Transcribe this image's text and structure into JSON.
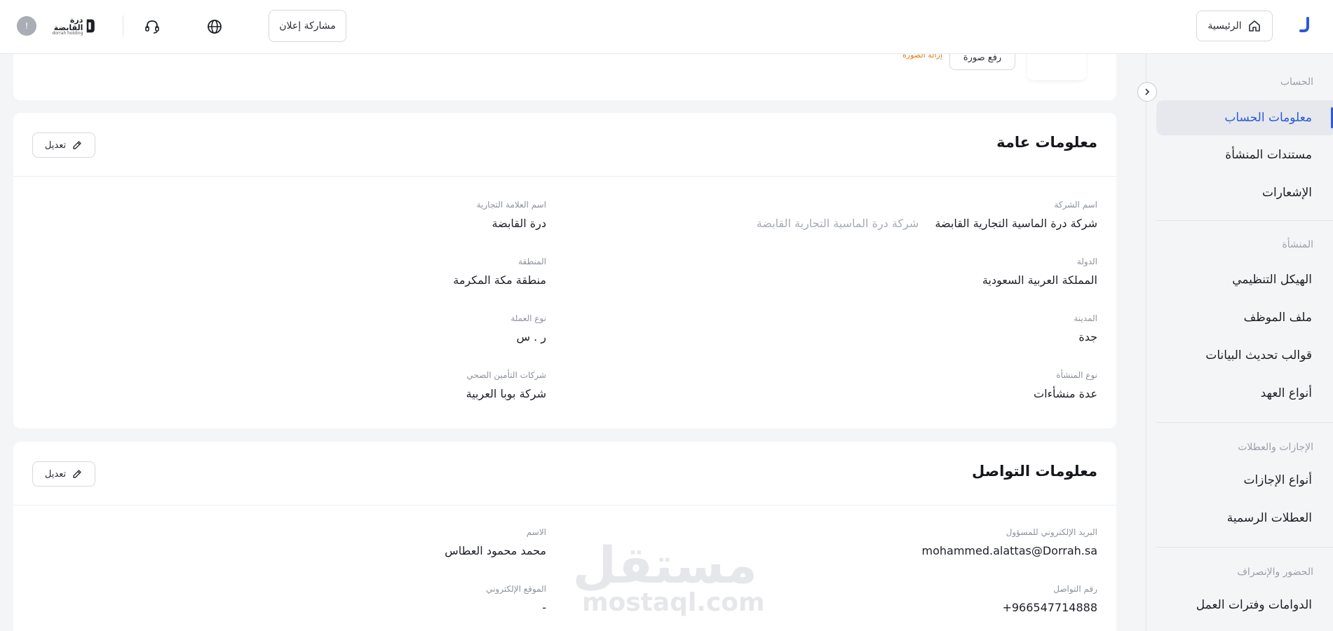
{
  "header": {
    "home_label": "الرئيسية",
    "share_label": "مشاركة إعلان",
    "logo_ar": "درة القابضة",
    "logo_en": "dorrah holding",
    "avatar_initial": "!"
  },
  "sidebar": {
    "section_account": "الحساب",
    "account_info": "معلومات الحساب",
    "entity_docs": "مستندات المنشأة",
    "notifications": "الإشعارات",
    "section_entity": "المنشأة",
    "org_structure": "الهيكل التنظيمي",
    "employee_file": "ملف الموظف",
    "data_update_templates": "قوالب تحديث البيانات",
    "custody_types": "أنواع العهد",
    "section_leaves": "الإجازات والعطلات",
    "leave_types": "أنواع الإجازات",
    "official_holidays": "العطلات الرسمية",
    "section_attendance": "الحضور والإنصراف",
    "shifts_periods": "الدوامات وفترات العمل"
  },
  "top_card": {
    "upload_label": "رفع صورة",
    "remove_label": "إزالة الصورة"
  },
  "general": {
    "title": "معلومات عامة",
    "edit_label": "تعديل",
    "company_name_label": "اسم الشركة",
    "company_name_value": "شركة درة الماسية التجارية القابضة",
    "company_name_hint": "شركة درة الماسية التجارية القابضة",
    "brand_name_label": "اسم العلامة التجارية",
    "brand_name_value": "درة القابضة",
    "country_label": "الدولة",
    "country_value": "المملكة العربية السعودية",
    "region_label": "المنطقة",
    "region_value": "منطقة مكة المكرمة",
    "city_label": "المدينة",
    "city_value": "جدة",
    "currency_label": "نوع العملة",
    "currency_value": "ر . س",
    "entity_type_label": "نوع المنشأة",
    "entity_type_value": "عدة منشأءات",
    "insurance_label": "شركات التأمين الصحي",
    "insurance_value": "شركة بوبا العربية"
  },
  "contact": {
    "title": "معلومات التواصل",
    "edit_label": "تعديل",
    "email_label": "البريد الإلكتروني للمسؤول",
    "email_value": "mohammed.alattas@Dorrah.sa",
    "name_label": "الاسم",
    "name_value": "محمد محمود العطاس",
    "phone_label": "رقم التواصل",
    "phone_value": "966547714888+",
    "website_label": "الموقع الإلكتروني",
    "website_value": "-"
  },
  "watermark": {
    "ar": "مستقل",
    "en": "mostaql.com"
  },
  "colors": {
    "accent": "#2a5ad6",
    "danger_link": "#e07b1a"
  }
}
